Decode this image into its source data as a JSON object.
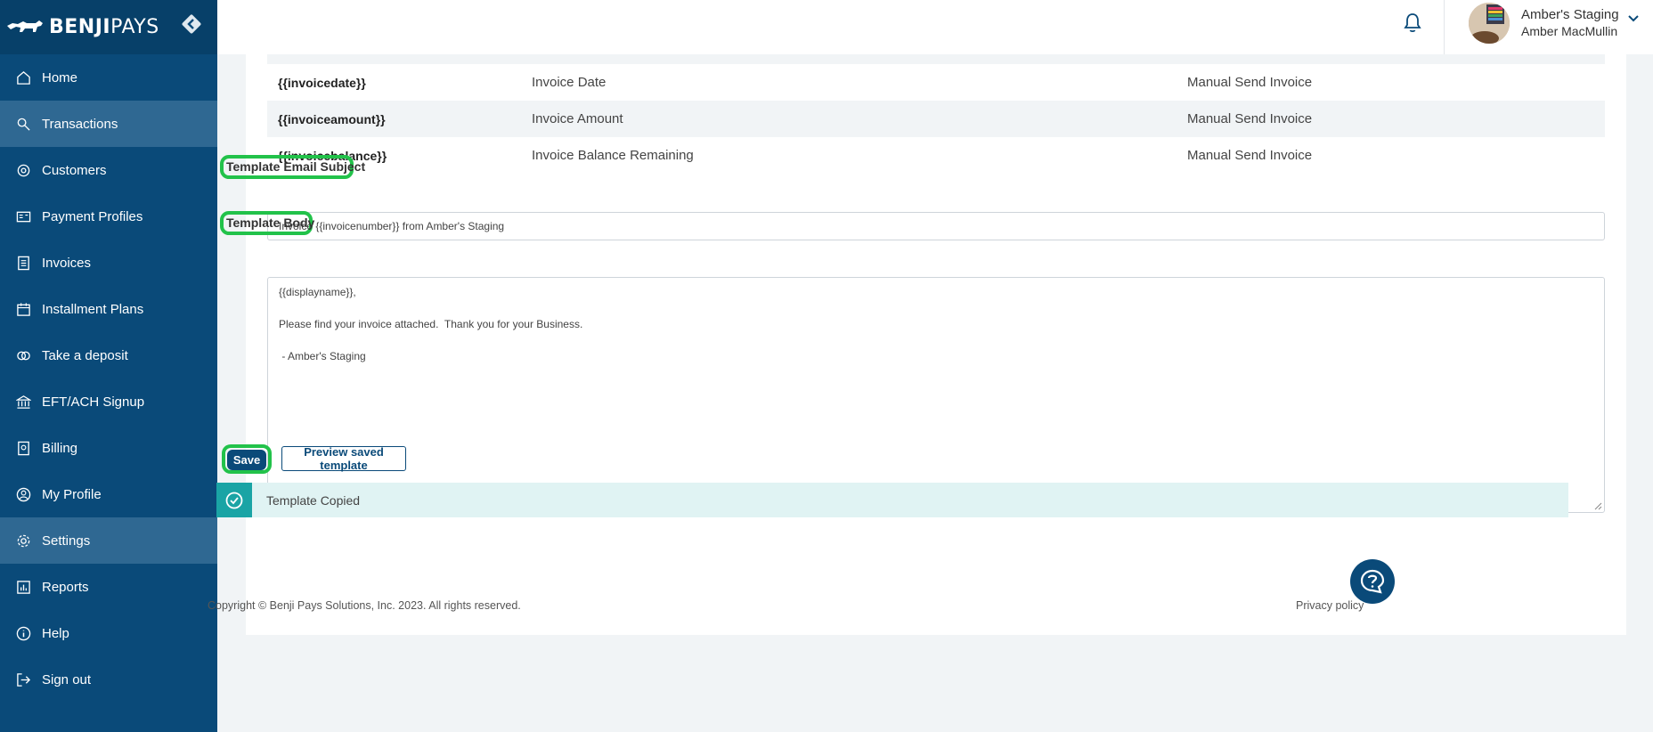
{
  "app": {
    "brand_bold": "BENJI",
    "brand_light": "PAYS"
  },
  "sidebar": {
    "items": [
      {
        "label": "Home",
        "icon": "home-icon",
        "active": false
      },
      {
        "label": "Transactions",
        "icon": "transactions-icon",
        "active": true
      },
      {
        "label": "Customers",
        "icon": "customers-icon",
        "active": false
      },
      {
        "label": "Payment Profiles",
        "icon": "payment-profiles-icon",
        "active": false
      },
      {
        "label": "Invoices",
        "icon": "invoices-icon",
        "active": false
      },
      {
        "label": "Installment Plans",
        "icon": "calendar-icon",
        "active": false
      },
      {
        "label": "Take a deposit",
        "icon": "deposit-icon",
        "active": false
      },
      {
        "label": "EFT/ACH Signup",
        "icon": "bank-icon",
        "active": false
      },
      {
        "label": "Billing",
        "icon": "billing-icon",
        "active": false
      },
      {
        "label": "My Profile",
        "icon": "profile-icon",
        "active": false
      },
      {
        "label": "Settings",
        "icon": "gear-icon",
        "active": true
      },
      {
        "label": "Reports",
        "icon": "reports-icon",
        "active": false
      },
      {
        "label": "Help",
        "icon": "info-icon",
        "active": false
      },
      {
        "label": "Sign out",
        "icon": "sign-out-icon",
        "active": false
      }
    ]
  },
  "header": {
    "company": "Amber's Staging",
    "user_name": "Amber MacMullin"
  },
  "placeholders": {
    "rows": [
      {
        "tag": "{{invoicedate}}",
        "description": "Invoice Date",
        "usage": "Manual Send Invoice"
      },
      {
        "tag": "{{invoiceamount}}",
        "description": "Invoice Amount",
        "usage": "Manual Send Invoice"
      },
      {
        "tag": "{{invoicebalance}}",
        "description": "Invoice Balance Remaining",
        "usage": "Manual Send Invoice"
      }
    ]
  },
  "form": {
    "subject_label": "Template Email Subject",
    "subject_value": "Invoice {{invoicenumber}} from Amber's Staging",
    "body_label": "Template Body",
    "body_lines": [
      "{{displayname}},",
      "",
      "Please find your invoice attached.  Thank you for your Business.",
      "",
      " - Amber's Staging"
    ],
    "save_label": "Save",
    "preview_label": "Preview saved template"
  },
  "toast": {
    "message": "Template Copied"
  },
  "footer": {
    "copyright": "Copyright © Benji Pays Solutions, Inc. 2023. All rights reserved.",
    "privacy": "Privacy policy"
  },
  "colors": {
    "sidebar_bg": "#0a4a79",
    "sidebar_active": "#2f6892",
    "highlight": "#22c24a",
    "toast_accent": "#1aa4a5",
    "toast_bg": "#e0f3f3"
  }
}
